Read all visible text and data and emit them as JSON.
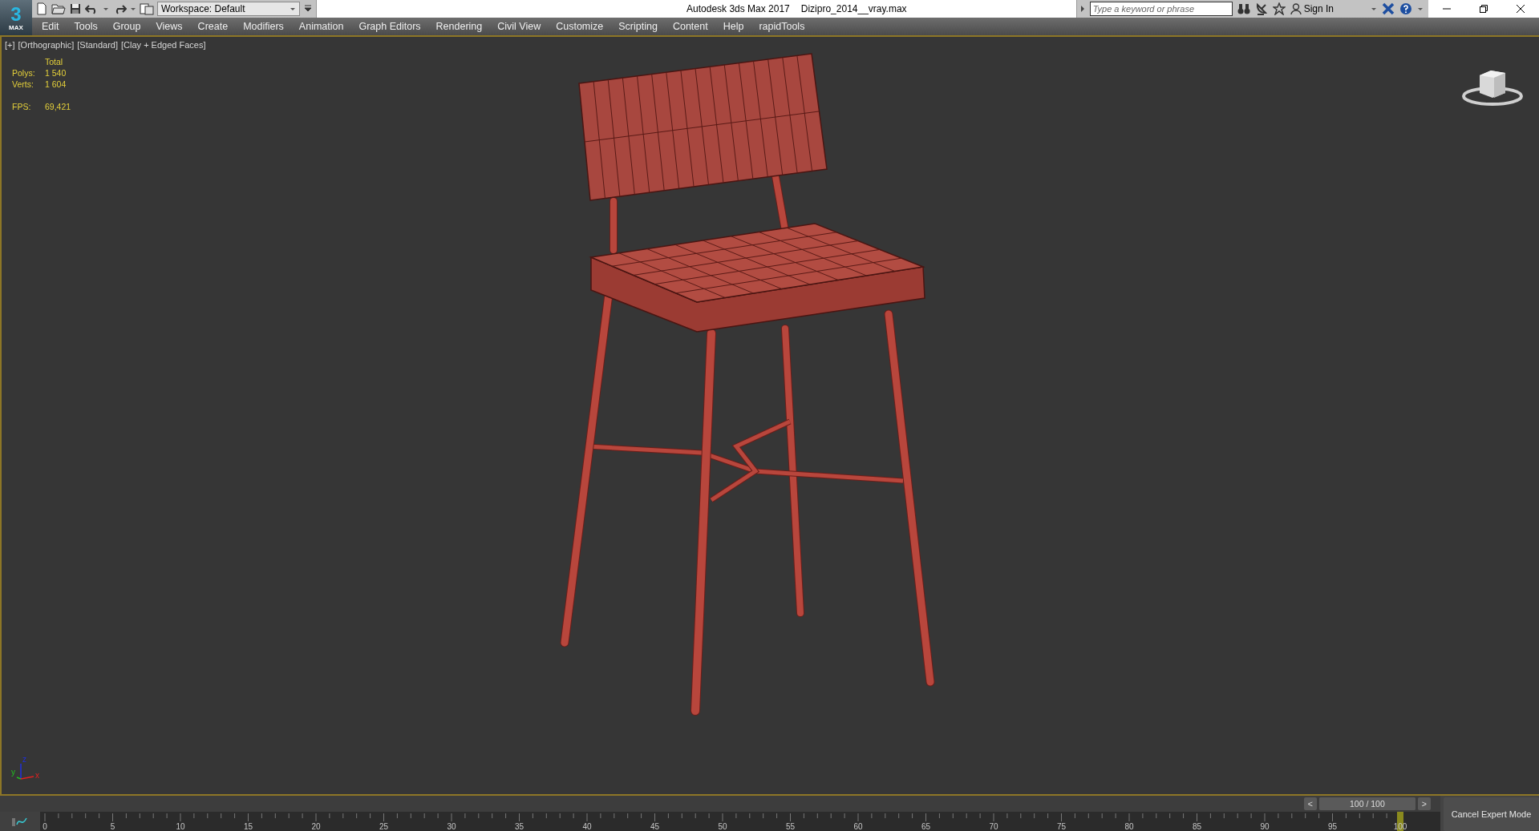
{
  "app_button": {
    "logo": "3",
    "caption": "MAX"
  },
  "workspace": {
    "value": "Workspace: Default"
  },
  "window": {
    "title": "Autodesk 3ds Max 2017",
    "file": "Dizipro_2014__vray.max"
  },
  "search": {
    "placeholder": "Type a keyword or phrase"
  },
  "account": {
    "label": "Sign In"
  },
  "menu": [
    "Edit",
    "Tools",
    "Group",
    "Views",
    "Create",
    "Modifiers",
    "Animation",
    "Graph Editors",
    "Rendering",
    "Civil View",
    "Customize",
    "Scripting",
    "Content",
    "Help",
    "rapidTools"
  ],
  "viewport": {
    "labels": [
      "[+]",
      "[Orthographic]",
      "[Standard]",
      "[Clay + Edged Faces]"
    ],
    "stats": {
      "heading": "Total",
      "rows": [
        {
          "label": "Polys:",
          "value": "1 540"
        },
        {
          "label": "Verts:",
          "value": "1 604"
        },
        {
          "label": "FPS:",
          "value": "69,421"
        }
      ]
    },
    "axes": {
      "x": "x",
      "y": "y",
      "z": "z"
    }
  },
  "time_slider": {
    "prev": "<",
    "reading": "100 / 100",
    "next": ">",
    "level": 1
  },
  "timeline": {
    "ticks": [
      "0",
      "5",
      "10",
      "15",
      "20",
      "25",
      "30",
      "35",
      "40",
      "45",
      "50",
      "55",
      "60",
      "65",
      "70",
      "75",
      "80",
      "85",
      "90",
      "95",
      "100"
    ]
  },
  "expert_button": "Cancel Expert Mode"
}
